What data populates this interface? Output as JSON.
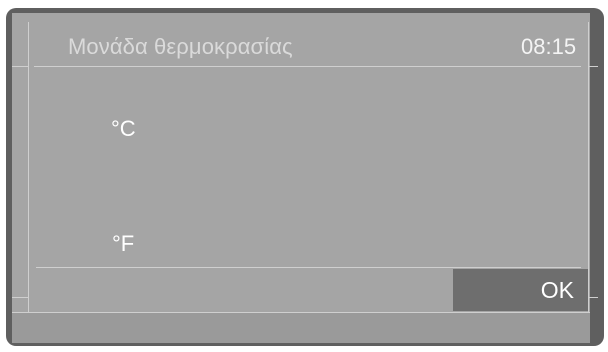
{
  "header": {
    "title": "Μονάδα θερμοκρασίας",
    "time": "08:15"
  },
  "options": [
    {
      "label": "°C"
    },
    {
      "label": "°F"
    }
  ],
  "footer": {
    "ok_label": "OK"
  },
  "colors": {
    "bezel": "#5f5f5f",
    "screen": "#a5a5a5",
    "ok_button": "#6e6e6e",
    "text": "#ffffff"
  }
}
